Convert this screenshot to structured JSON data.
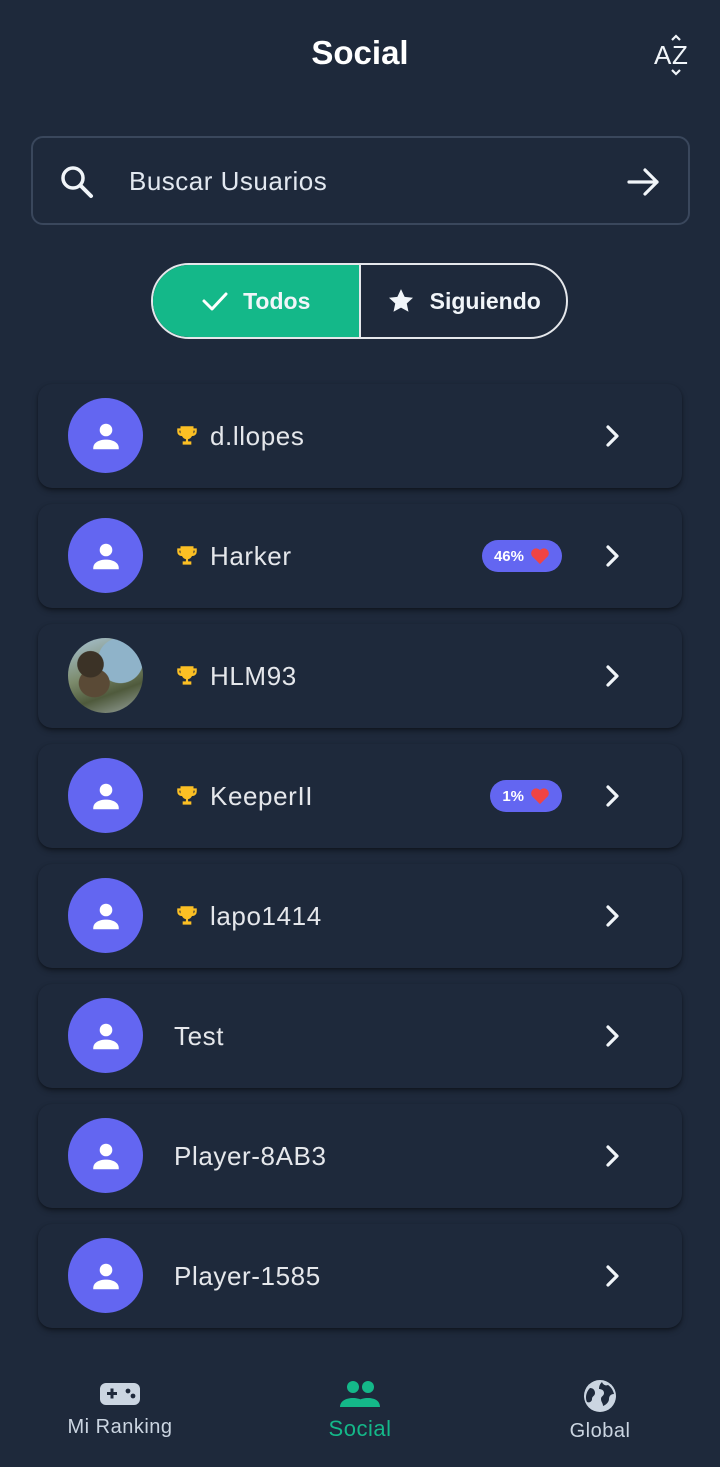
{
  "header": {
    "title": "Social",
    "sort_icon": "sort-az-icon"
  },
  "search": {
    "placeholder": "Buscar Usuarios",
    "value": ""
  },
  "filters": {
    "all_label": "Todos",
    "following_label": "Siguiendo",
    "selected": "Todos"
  },
  "users": [
    {
      "name": "d.llopes",
      "trophy": true,
      "badge": "",
      "avatar": "default"
    },
    {
      "name": "Harker",
      "trophy": true,
      "badge": "46%",
      "avatar": "default"
    },
    {
      "name": "HLM93",
      "trophy": true,
      "badge": "",
      "avatar": "photo"
    },
    {
      "name": "KeeperII",
      "trophy": true,
      "badge": "1%",
      "avatar": "default"
    },
    {
      "name": "lapo1414",
      "trophy": true,
      "badge": "",
      "avatar": "default"
    },
    {
      "name": "Test",
      "trophy": false,
      "badge": "",
      "avatar": "default"
    },
    {
      "name": "Player-8AB3",
      "trophy": false,
      "badge": "",
      "avatar": "default"
    },
    {
      "name": "Player-1585",
      "trophy": false,
      "badge": "",
      "avatar": "default"
    }
  ],
  "bottom_nav": {
    "items": [
      {
        "label": "Mi Ranking",
        "icon": "gamepad-icon"
      },
      {
        "label": "Social",
        "icon": "people-icon"
      },
      {
        "label": "Global",
        "icon": "globe-icon"
      }
    ],
    "active": "Social"
  },
  "colors": {
    "background": "#1e293b",
    "accent": "#14b889",
    "avatar": "#6366f1",
    "trophy": "#fbbf24",
    "heart": "#ef4444"
  }
}
